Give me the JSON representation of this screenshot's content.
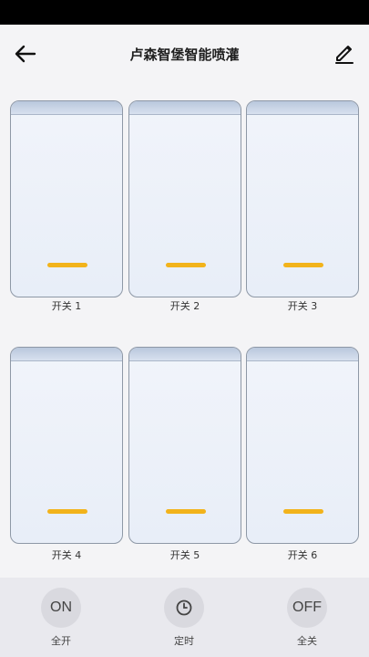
{
  "header": {
    "title": "卢森智堡智能喷灌"
  },
  "switches": [
    {
      "label": "开关 1"
    },
    {
      "label": "开关 2"
    },
    {
      "label": "开关 3"
    },
    {
      "label": "开关 4"
    },
    {
      "label": "开关 5"
    },
    {
      "label": "开关 6"
    }
  ],
  "actions": {
    "all_on": {
      "icon_text": "ON",
      "label": "全开"
    },
    "timer": {
      "icon": "clock-icon",
      "label": "定时"
    },
    "all_off": {
      "icon_text": "OFF",
      "label": "全关"
    }
  },
  "colors": {
    "accent": "#f2b31b",
    "card_border": "#8e98a6",
    "background": "#f4f4f6"
  }
}
